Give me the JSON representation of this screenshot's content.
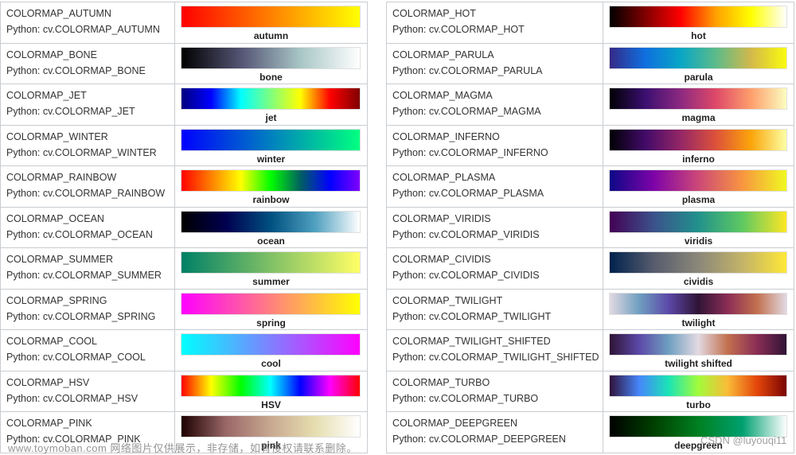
{
  "left_table": [
    {
      "constant": "COLORMAP_AUTUMN",
      "python": "Python: cv.COLORMAP_AUTUMN",
      "label": "autumn",
      "stops": [
        "#ff0000",
        "#ff8000",
        "#ffff00"
      ]
    },
    {
      "constant": "COLORMAP_BONE",
      "python": "Python: cv.COLORMAP_BONE",
      "label": "bone",
      "stops": [
        "#000000",
        "#545474",
        "#a8c6c6",
        "#ffffff"
      ]
    },
    {
      "constant": "COLORMAP_JET",
      "python": "Python: cv.COLORMAP_JET",
      "label": "jet",
      "stops": [
        "#00007f",
        "#0000ff",
        "#00ffff",
        "#7fff7f",
        "#ffff00",
        "#ff0000",
        "#7f0000"
      ]
    },
    {
      "constant": "COLORMAP_WINTER",
      "python": "Python: cv.COLORMAP_WINTER",
      "label": "winter",
      "stops": [
        "#0000ff",
        "#0080bf",
        "#00ff80"
      ]
    },
    {
      "constant": "COLORMAP_RAINBOW",
      "python": "Python: cv.COLORMAP_RAINBOW",
      "label": "rainbow",
      "stops": [
        "#ff0000",
        "#ff8000",
        "#ffff00",
        "#00ff00",
        "#006060",
        "#0000ff",
        "#8000ff"
      ]
    },
    {
      "constant": "COLORMAP_OCEAN",
      "python": "Python: cv.COLORMAP_OCEAN",
      "label": "ocean",
      "stops": [
        "#000000",
        "#000050",
        "#005080",
        "#50a0c0",
        "#ffffff"
      ]
    },
    {
      "constant": "COLORMAP_SUMMER",
      "python": "Python: cv.COLORMAP_SUMMER",
      "label": "summer",
      "stops": [
        "#008066",
        "#80c066",
        "#ffff66"
      ]
    },
    {
      "constant": "COLORMAP_SPRING",
      "python": "Python: cv.COLORMAP_SPRING",
      "label": "spring",
      "stops": [
        "#ff00ff",
        "#ff8080",
        "#ffff00"
      ]
    },
    {
      "constant": "COLORMAP_COOL",
      "python": "Python: cv.COLORMAP_COOL",
      "label": "cool",
      "stops": [
        "#00ffff",
        "#8080ff",
        "#ff00ff"
      ]
    },
    {
      "constant": "COLORMAP_HSV",
      "python": "Python: cv.COLORMAP_HSV",
      "label": "HSV",
      "stops": [
        "#ff0000",
        "#ffff00",
        "#00ff00",
        "#00ffff",
        "#0000ff",
        "#ff00ff",
        "#ff0000"
      ]
    },
    {
      "constant": "COLORMAP_PINK",
      "python": "Python: cv.COLORMAP_PINK",
      "label": "pink",
      "stops": [
        "#1e0000",
        "#9a6868",
        "#c8a890",
        "#e6deb0",
        "#ffffff"
      ]
    }
  ],
  "right_table": [
    {
      "constant": "COLORMAP_HOT",
      "python": "Python: cv.COLORMAP_HOT",
      "label": "hot",
      "stops": [
        "#000000",
        "#800000",
        "#ff0000",
        "#ffa000",
        "#ffff00",
        "#ffffff"
      ]
    },
    {
      "constant": "COLORMAP_PARULA",
      "python": "Python: cv.COLORMAP_PARULA",
      "label": "parula",
      "stops": [
        "#352a87",
        "#0f6fdf",
        "#08a6c6",
        "#5cbb8a",
        "#d3b94b",
        "#f9fb0e"
      ]
    },
    {
      "constant": "COLORMAP_MAGMA",
      "python": "Python: cv.COLORMAP_MAGMA",
      "label": "magma",
      "stops": [
        "#000004",
        "#3b0f70",
        "#8c2981",
        "#de4968",
        "#fe9f6d",
        "#fcfdbf"
      ]
    },
    {
      "constant": "COLORMAP_INFERNO",
      "python": "Python: cv.COLORMAP_INFERNO",
      "label": "inferno",
      "stops": [
        "#000004",
        "#420a68",
        "#932667",
        "#dd513a",
        "#fca50a",
        "#fcffa4"
      ]
    },
    {
      "constant": "COLORMAP_PLASMA",
      "python": "Python: cv.COLORMAP_PLASMA",
      "label": "plasma",
      "stops": [
        "#0d0887",
        "#7e03a8",
        "#cc4778",
        "#f89540",
        "#f0f921"
      ]
    },
    {
      "constant": "COLORMAP_VIRIDIS",
      "python": "Python: cv.COLORMAP_VIRIDIS",
      "label": "viridis",
      "stops": [
        "#440154",
        "#3b528b",
        "#21918c",
        "#5ec962",
        "#fde725"
      ]
    },
    {
      "constant": "COLORMAP_CIVIDIS",
      "python": "Python: cv.COLORMAP_CIVIDIS",
      "label": "cividis",
      "stops": [
        "#00224e",
        "#575c6d",
        "#8a8779",
        "#c3b369",
        "#fee838"
      ]
    },
    {
      "constant": "COLORMAP_TWILIGHT",
      "python": "Python: cv.COLORMAP_TWILIGHT",
      "label": "twilight",
      "stops": [
        "#e2d9e2",
        "#6e9fc0",
        "#5c48a8",
        "#2f1436",
        "#8a2d55",
        "#c2704f",
        "#e2d9e2"
      ]
    },
    {
      "constant": "COLORMAP_TWILIGHT_SHIFTED",
      "python": "Python: cv.COLORMAP_TWILIGHT_SHIFTED",
      "label": "twilight shifted",
      "stops": [
        "#2f1436",
        "#5c48a8",
        "#6e9fc0",
        "#e2d9e2",
        "#c2704f",
        "#8a2d55",
        "#2f1436"
      ]
    },
    {
      "constant": "COLORMAP_TURBO",
      "python": "Python: cv.COLORMAP_TURBO",
      "label": "turbo",
      "stops": [
        "#30123b",
        "#4686fb",
        "#1ae4b6",
        "#a2fc3c",
        "#fabb38",
        "#e4460a",
        "#7a0403"
      ]
    },
    {
      "constant": "COLORMAP_DEEPGREEN",
      "python": "Python: cv.COLORMAP_DEEPGREEN",
      "label": "deepgreen",
      "stops": [
        "#000000",
        "#004000",
        "#008020",
        "#00a070",
        "#ffffff"
      ]
    }
  ],
  "overlays": {
    "watermark": "www.toymoban.com 网络图片仅供展示，非存储，如有侵权请联系删除。",
    "credit": "CSDN @luyouqi11"
  }
}
